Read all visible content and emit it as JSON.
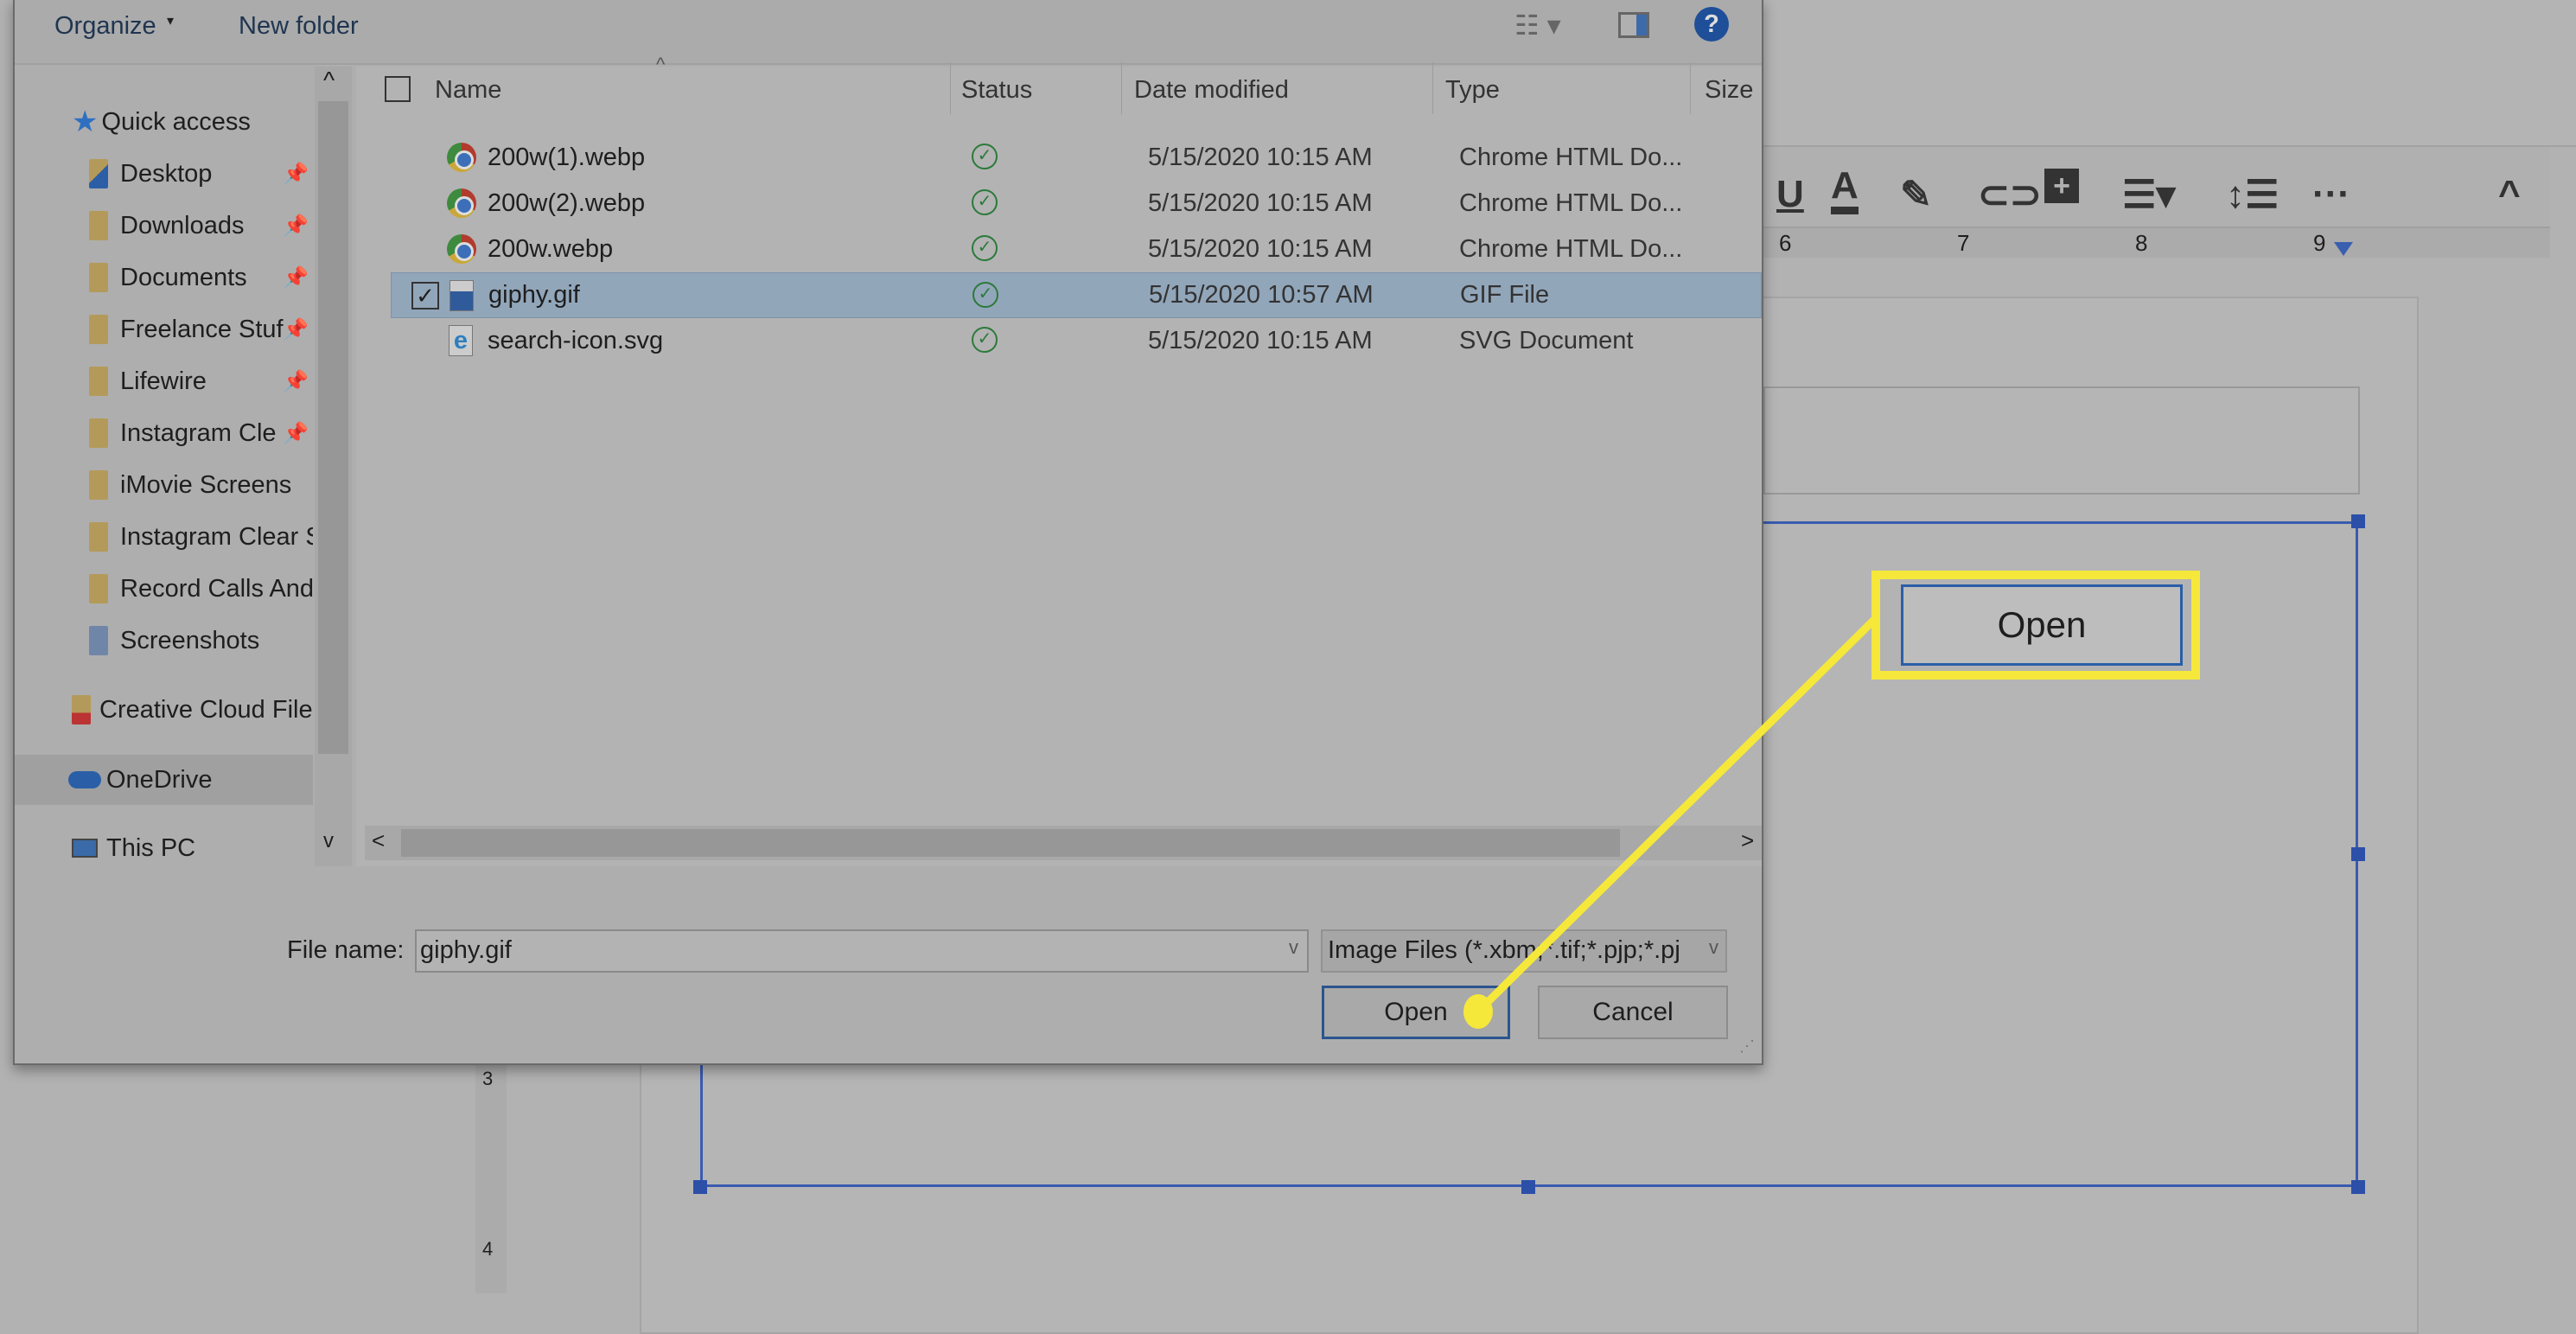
{
  "background_doc": {
    "toolbar_icons": [
      "underline-icon",
      "text-color-icon",
      "highlight-icon",
      "link-icon",
      "add-comment-icon",
      "align-icon",
      "line-spacing-icon",
      "more-icon",
      "collapse-icon"
    ],
    "ruler_labels": [
      "6",
      "7",
      "8",
      "9"
    ],
    "vertical_ruler_labels": [
      "3",
      "4"
    ]
  },
  "dialog": {
    "toolbar": {
      "organize": "Organize",
      "new_folder": "New folder"
    },
    "nav": [
      {
        "label": "Quick access",
        "icon": "star-icon"
      },
      {
        "label": "Desktop",
        "pinned": true
      },
      {
        "label": "Downloads",
        "pinned": true
      },
      {
        "label": "Documents",
        "pinned": true
      },
      {
        "label": "Freelance Stuf",
        "pinned": true
      },
      {
        "label": "Lifewire",
        "pinned": true
      },
      {
        "label": "Instagram Cle",
        "pinned": true
      },
      {
        "label": "iMovie Screens"
      },
      {
        "label": "Instagram Clear S"
      },
      {
        "label": "Record Calls And"
      },
      {
        "label": "Screenshots"
      },
      {
        "label": "Creative Cloud File",
        "icon": "creative-cloud-icon"
      },
      {
        "label": "OneDrive",
        "icon": "onedrive-icon",
        "selected": true
      },
      {
        "label": "This PC",
        "icon": "pc-icon"
      }
    ],
    "columns": {
      "name": "Name",
      "status": "Status",
      "date": "Date modified",
      "type": "Type",
      "size": "Size"
    },
    "files": [
      {
        "name": "200w(1).webp",
        "date": "5/15/2020 10:15 AM",
        "type": "Chrome HTML Do...",
        "icon": "chrome-icon"
      },
      {
        "name": "200w(2).webp",
        "date": "5/15/2020 10:15 AM",
        "type": "Chrome HTML Do...",
        "icon": "chrome-icon"
      },
      {
        "name": "200w.webp",
        "date": "5/15/2020 10:15 AM",
        "type": "Chrome HTML Do...",
        "icon": "chrome-icon"
      },
      {
        "name": "giphy.gif",
        "date": "5/15/2020 10:57 AM",
        "type": "GIF File",
        "icon": "image-file-icon",
        "selected": true
      },
      {
        "name": "search-icon.svg",
        "date": "5/15/2020 10:15 AM",
        "type": "SVG Document",
        "icon": "ie-file-icon"
      }
    ],
    "file_name_label": "File name:",
    "file_name_value": "giphy.gif",
    "file_type_filter": "Image Files (*.xbm;*.tif;*.pjp;*.pj",
    "open_label": "Open",
    "cancel_label": "Cancel"
  },
  "callout": {
    "label": "Open",
    "color": "#f5e83a"
  }
}
